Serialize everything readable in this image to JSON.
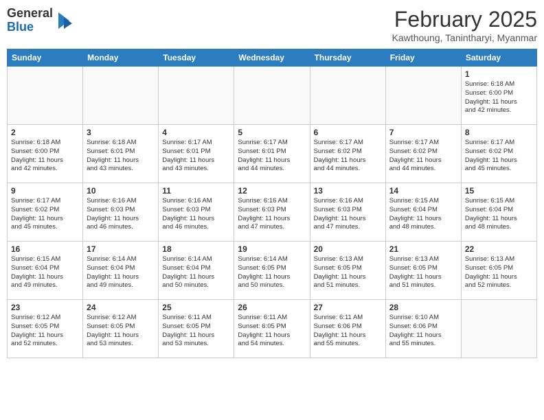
{
  "header": {
    "logo_general": "General",
    "logo_blue": "Blue",
    "month_title": "February 2025",
    "location": "Kawthoung, Tanintharyi, Myanmar"
  },
  "weekdays": [
    "Sunday",
    "Monday",
    "Tuesday",
    "Wednesday",
    "Thursday",
    "Friday",
    "Saturday"
  ],
  "weeks": [
    [
      {
        "day": "",
        "info": ""
      },
      {
        "day": "",
        "info": ""
      },
      {
        "day": "",
        "info": ""
      },
      {
        "day": "",
        "info": ""
      },
      {
        "day": "",
        "info": ""
      },
      {
        "day": "",
        "info": ""
      },
      {
        "day": "1",
        "info": "Sunrise: 6:18 AM\nSunset: 6:00 PM\nDaylight: 11 hours\nand 42 minutes."
      }
    ],
    [
      {
        "day": "2",
        "info": "Sunrise: 6:18 AM\nSunset: 6:00 PM\nDaylight: 11 hours\nand 42 minutes."
      },
      {
        "day": "3",
        "info": "Sunrise: 6:18 AM\nSunset: 6:01 PM\nDaylight: 11 hours\nand 43 minutes."
      },
      {
        "day": "4",
        "info": "Sunrise: 6:17 AM\nSunset: 6:01 PM\nDaylight: 11 hours\nand 43 minutes."
      },
      {
        "day": "5",
        "info": "Sunrise: 6:17 AM\nSunset: 6:01 PM\nDaylight: 11 hours\nand 44 minutes."
      },
      {
        "day": "6",
        "info": "Sunrise: 6:17 AM\nSunset: 6:02 PM\nDaylight: 11 hours\nand 44 minutes."
      },
      {
        "day": "7",
        "info": "Sunrise: 6:17 AM\nSunset: 6:02 PM\nDaylight: 11 hours\nand 44 minutes."
      },
      {
        "day": "8",
        "info": "Sunrise: 6:17 AM\nSunset: 6:02 PM\nDaylight: 11 hours\nand 45 minutes."
      }
    ],
    [
      {
        "day": "9",
        "info": "Sunrise: 6:17 AM\nSunset: 6:02 PM\nDaylight: 11 hours\nand 45 minutes."
      },
      {
        "day": "10",
        "info": "Sunrise: 6:16 AM\nSunset: 6:03 PM\nDaylight: 11 hours\nand 46 minutes."
      },
      {
        "day": "11",
        "info": "Sunrise: 6:16 AM\nSunset: 6:03 PM\nDaylight: 11 hours\nand 46 minutes."
      },
      {
        "day": "12",
        "info": "Sunrise: 6:16 AM\nSunset: 6:03 PM\nDaylight: 11 hours\nand 47 minutes."
      },
      {
        "day": "13",
        "info": "Sunrise: 6:16 AM\nSunset: 6:03 PM\nDaylight: 11 hours\nand 47 minutes."
      },
      {
        "day": "14",
        "info": "Sunrise: 6:15 AM\nSunset: 6:04 PM\nDaylight: 11 hours\nand 48 minutes."
      },
      {
        "day": "15",
        "info": "Sunrise: 6:15 AM\nSunset: 6:04 PM\nDaylight: 11 hours\nand 48 minutes."
      }
    ],
    [
      {
        "day": "16",
        "info": "Sunrise: 6:15 AM\nSunset: 6:04 PM\nDaylight: 11 hours\nand 49 minutes."
      },
      {
        "day": "17",
        "info": "Sunrise: 6:14 AM\nSunset: 6:04 PM\nDaylight: 11 hours\nand 49 minutes."
      },
      {
        "day": "18",
        "info": "Sunrise: 6:14 AM\nSunset: 6:04 PM\nDaylight: 11 hours\nand 50 minutes."
      },
      {
        "day": "19",
        "info": "Sunrise: 6:14 AM\nSunset: 6:05 PM\nDaylight: 11 hours\nand 50 minutes."
      },
      {
        "day": "20",
        "info": "Sunrise: 6:13 AM\nSunset: 6:05 PM\nDaylight: 11 hours\nand 51 minutes."
      },
      {
        "day": "21",
        "info": "Sunrise: 6:13 AM\nSunset: 6:05 PM\nDaylight: 11 hours\nand 51 minutes."
      },
      {
        "day": "22",
        "info": "Sunrise: 6:13 AM\nSunset: 6:05 PM\nDaylight: 11 hours\nand 52 minutes."
      }
    ],
    [
      {
        "day": "23",
        "info": "Sunrise: 6:12 AM\nSunset: 6:05 PM\nDaylight: 11 hours\nand 52 minutes."
      },
      {
        "day": "24",
        "info": "Sunrise: 6:12 AM\nSunset: 6:05 PM\nDaylight: 11 hours\nand 53 minutes."
      },
      {
        "day": "25",
        "info": "Sunrise: 6:11 AM\nSunset: 6:05 PM\nDaylight: 11 hours\nand 53 minutes."
      },
      {
        "day": "26",
        "info": "Sunrise: 6:11 AM\nSunset: 6:05 PM\nDaylight: 11 hours\nand 54 minutes."
      },
      {
        "day": "27",
        "info": "Sunrise: 6:11 AM\nSunset: 6:06 PM\nDaylight: 11 hours\nand 55 minutes."
      },
      {
        "day": "28",
        "info": "Sunrise: 6:10 AM\nSunset: 6:06 PM\nDaylight: 11 hours\nand 55 minutes."
      },
      {
        "day": "",
        "info": ""
      }
    ]
  ]
}
